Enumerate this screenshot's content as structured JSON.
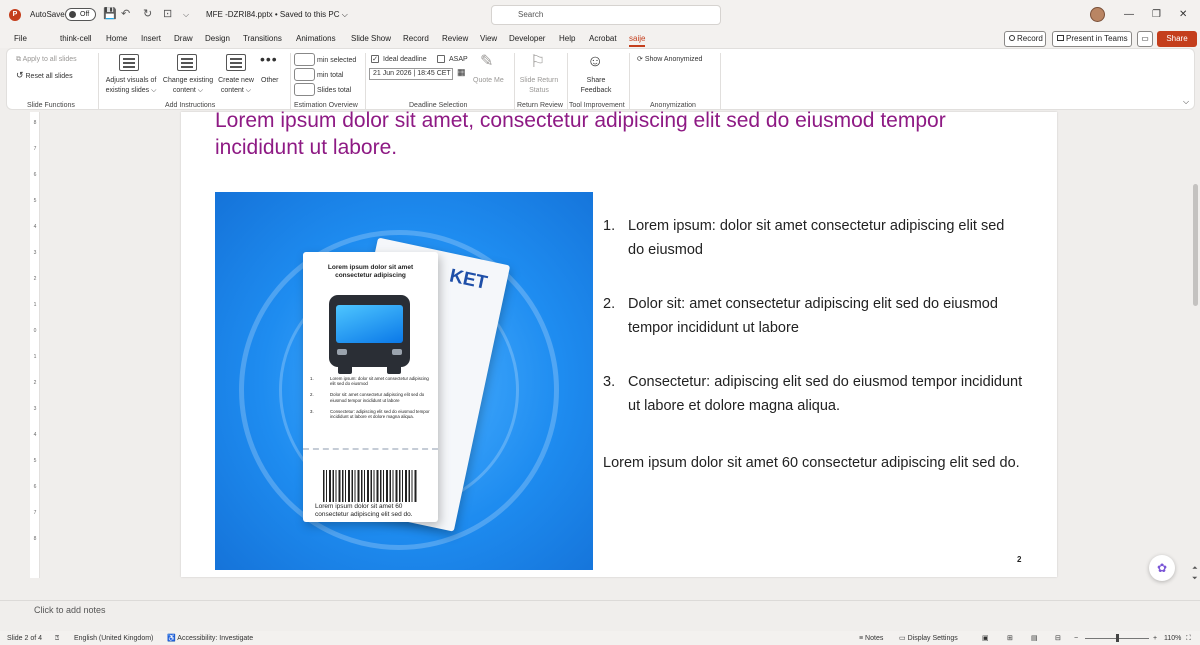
{
  "titlebar": {
    "app_letter": "P",
    "autosave_label": "AutoSave",
    "autosave_state": "Off",
    "filename": "MFE -DZRI84.pptx • Saved to this PC ⌵",
    "search_placeholder": "Search",
    "win_min": "—",
    "win_max": "❐",
    "win_close": "✕"
  },
  "menu": {
    "tabs": [
      "File",
      "think-cell",
      "Home",
      "Insert",
      "Draw",
      "Design",
      "Transitions",
      "Animations",
      "Slide Show",
      "Record",
      "Review",
      "View",
      "Developer",
      "Help",
      "Acrobat",
      "saije"
    ],
    "active_tab": "saije",
    "record_label": "Record",
    "present_label": "Present in Teams",
    "share_label": "Share"
  },
  "ribbon": {
    "apply_all": "Apply to all slides",
    "reset_all": "Reset all slides",
    "group_slide_functions": "Slide Functions",
    "adjust_visuals_1": "Adjust visuals of",
    "adjust_visuals_2": "existing slides ⌵",
    "change_content_1": "Change existing",
    "change_content_2": "content ⌵",
    "create_content_1": "Create new",
    "create_content_2": "content ⌵",
    "other": "Other",
    "group_add_instructions": "Add Instructions",
    "min_selected": "min selected",
    "min_total": "min total",
    "slides_total": "Slides total",
    "group_estimation": "Estimation Overview",
    "ideal_deadline": "Ideal deadline",
    "asap": "ASAP",
    "deadline_value": "21 Jun 2026 | 18:45 CET",
    "quote_me": "Quote Me",
    "group_deadline": "Deadline Selection",
    "slide_return_1": "Slide Return",
    "slide_return_2": "Status",
    "group_return": "Return Review",
    "share_feedback_1": "Share",
    "share_feedback_2": "Feedback",
    "group_tool": "Tool Improvement",
    "show_anonymized": "Show Anonymized",
    "group_anonymization": "Anonymization"
  },
  "ruler": {
    "numbers": [
      "8",
      "7",
      "6",
      "5",
      "4",
      "3",
      "2",
      "1",
      "0",
      "1",
      "2",
      "3",
      "4",
      "5",
      "6",
      "7",
      "8"
    ]
  },
  "slide": {
    "title": "Lorem ipsum dolor sit amet, consectetur adipiscing elit sed do eiusmod tempor incididunt ut labore.",
    "image": {
      "ticket_title": "Lorem ipsum dolor sit amet consectetur adipiscing",
      "ticket_back_text": "KET",
      "ticket_items": [
        {
          "num": "1.",
          "text": "Lorem ipsum: dolor sit amet consectetur adipiscing elit sed do eiusmod"
        },
        {
          "num": "2.",
          "text": "Dolor sit: amet consectetur adipiscing elit sed do eiusmod tempor incididunt ut labore"
        },
        {
          "num": "3.",
          "text": "Consectetur: adipiscing elit sed do eiusmod tempor incididunt ut labore et dolore magna aliqua."
        }
      ],
      "ticket_footer": "Lorem ipsum dolor sit amet 60 consectetur adipiscing elit sed do."
    },
    "list": [
      {
        "num": "1.",
        "text": "Lorem ipsum: dolor sit amet consectetur adipiscing elit sed do eiusmod"
      },
      {
        "num": "2.",
        "text": "Dolor sit: amet consectetur adipiscing elit sed do eiusmod tempor incididunt ut labore"
      },
      {
        "num": "3.",
        "text": "Consectetur: adipiscing elit sed do eiusmod tempor incididunt ut labore et dolore magna aliqua."
      }
    ],
    "paragraph": "Lorem ipsum dolor sit amet 60 consectetur adipiscing elit sed do.",
    "page_number": "2"
  },
  "notes": {
    "placeholder": "Click to add notes"
  },
  "status": {
    "slide_info": "Slide 2 of 4",
    "language": "English (United Kingdom)",
    "accessibility": "Accessibility: Investigate",
    "notes": "Notes",
    "display_settings": "Display Settings",
    "zoom": "110%",
    "zoom_minus": "−",
    "zoom_plus": "+"
  },
  "colors": {
    "accent": "#c43e1c",
    "title": "#8e1a84",
    "image_blue": "#1e8cf0"
  }
}
